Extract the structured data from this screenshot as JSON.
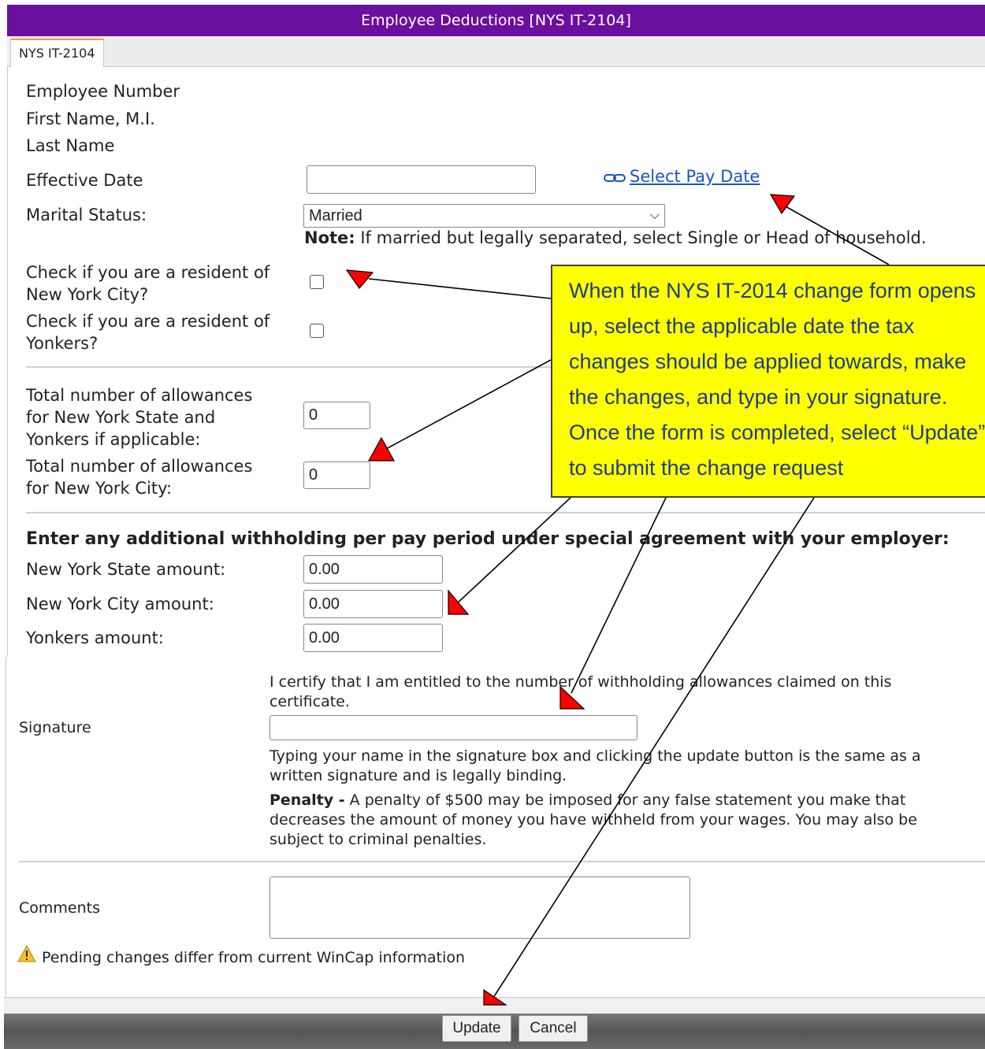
{
  "window": {
    "title": "Employee Deductions [NYS IT-2104]"
  },
  "tabs": [
    {
      "label": "NYS IT-2104"
    }
  ],
  "employee": {
    "number_label": "Employee Number",
    "first_name_label": "First Name, M.I.",
    "last_name_label": "Last Name"
  },
  "effective_date": {
    "label": "Effective Date",
    "value": "",
    "link_label": "Select Pay Date"
  },
  "marital": {
    "label": "Marital Status:",
    "selected": "Married",
    "note_bold": "Note:",
    "note_text": " If married but legally separated, select Single or Head of household."
  },
  "residency": {
    "nyc_label_1": "Check if you are a resident of",
    "nyc_label_2": "New York City?",
    "nyc_checked": false,
    "yonkers_label_1": "Check if you are a resident of",
    "yonkers_label_2": "Yonkers?",
    "yonkers_checked": false
  },
  "allowances": {
    "state_label_1": "Total number of allowances",
    "state_label_2": "for New York State and",
    "state_label_3": "Yonkers if applicable:",
    "state_value": "0",
    "city_label_1": "Total number of allowances",
    "city_label_2": "for New York City:",
    "city_value": "0"
  },
  "additional": {
    "heading": "Enter any additional withholding per pay period under special agreement with your employer:",
    "state_label": "New York State amount:",
    "state_value": "0.00",
    "city_label": "New York City amount:",
    "city_value": "0.00",
    "yonkers_label": "Yonkers amount:",
    "yonkers_value": "0.00"
  },
  "signature": {
    "label": "Signature",
    "certify_1": "I certify that I am entitled to the number of withholding allowances claimed on this",
    "certify_2": "certificate.",
    "value": "",
    "typing_1": "Typing your name in the signature box and clicking the update button is the same as a",
    "typing_2": "written signature and is legally binding.",
    "penalty_bold": "Penalty -",
    "penalty_1": " A penalty of $500 may be imposed for any false statement you make that",
    "penalty_2": "decreases the amount of money you have withheld from your wages. You may also be",
    "penalty_3": "subject to criminal penalties."
  },
  "comments": {
    "label": "Comments",
    "value": ""
  },
  "warning": {
    "text": "Pending changes differ from current WinCap information"
  },
  "buttons": {
    "update": "Update",
    "cancel": "Cancel"
  },
  "callout": {
    "lines": [
      "When the NYS IT-2014 change form opens",
      "up, select the applicable date the tax",
      "changes should be applied towards, make",
      "the changes, and type in your signature.",
      "Once the form is completed, select “Update”",
      "to submit the change request"
    ]
  },
  "colors": {
    "titlebar": "#6a0f9e",
    "callout_fill": "#ffff00",
    "arrow_head": "#ff0000",
    "link": "#1a55c7"
  }
}
